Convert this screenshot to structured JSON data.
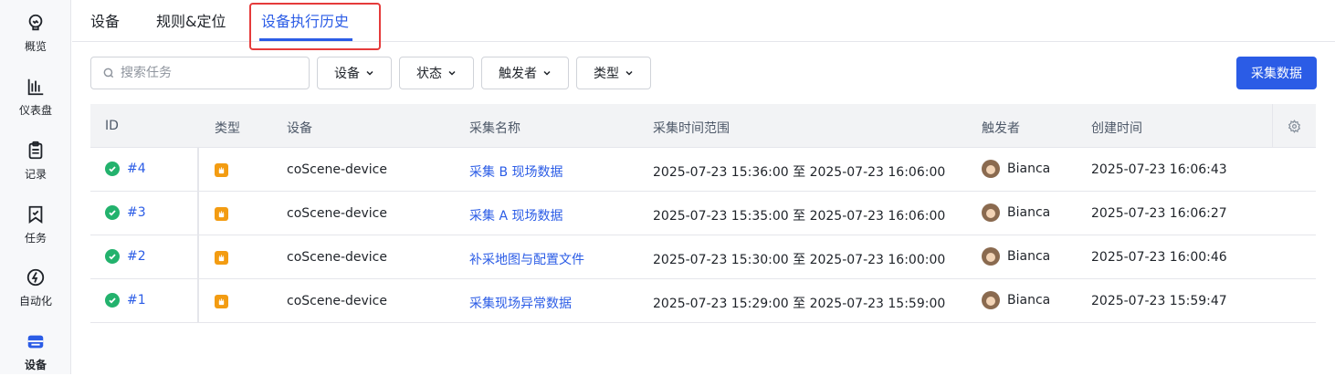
{
  "sidebar": {
    "items": [
      {
        "label": "概览",
        "icon": "bulb-icon"
      },
      {
        "label": "仪表盘",
        "icon": "bar-chart-icon"
      },
      {
        "label": "记录",
        "icon": "clipboard-icon"
      },
      {
        "label": "任务",
        "icon": "task-icon"
      },
      {
        "label": "自动化",
        "icon": "automation-icon"
      },
      {
        "label": "设备",
        "icon": "device-icon",
        "active": true
      }
    ]
  },
  "tabs": [
    {
      "label": "设备"
    },
    {
      "label": "规则&定位"
    },
    {
      "label": "设备执行历史",
      "active": true
    }
  ],
  "toolbar": {
    "search_placeholder": "搜索任务",
    "filters": [
      {
        "label": "设备"
      },
      {
        "label": "状态"
      },
      {
        "label": "触发者"
      },
      {
        "label": "类型"
      }
    ],
    "collect_button": "采集数据"
  },
  "table": {
    "columns": [
      "ID",
      "类型",
      "设备",
      "采集名称",
      "采集时间范围",
      "触发者",
      "创建时间"
    ],
    "rows": [
      {
        "id": "#4",
        "device": "coScene-device",
        "name": "采集 B 现场数据",
        "range": "2025-07-23 15:36:00 至 2025-07-23 16:06:00",
        "trigger": "Bianca",
        "created": "2025-07-23 16:06:43"
      },
      {
        "id": "#3",
        "device": "coScene-device",
        "name": "采集 A 现场数据",
        "range": "2025-07-23 15:35:00 至 2025-07-23 16:06:00",
        "trigger": "Bianca",
        "created": "2025-07-23 16:06:27"
      },
      {
        "id": "#2",
        "device": "coScene-device",
        "name": "补采地图与配置文件",
        "range": "2025-07-23 15:30:00 至 2025-07-23 16:00:00",
        "trigger": "Bianca",
        "created": "2025-07-23 16:00:46"
      },
      {
        "id": "#1",
        "device": "coScene-device",
        "name": "采集现场异常数据",
        "range": "2025-07-23 15:29:00 至 2025-07-23 15:59:00",
        "trigger": "Bianca",
        "created": "2025-07-23 15:59:47"
      }
    ]
  },
  "colors": {
    "accent": "#2b5ce6",
    "success": "#23b26d",
    "type_badge": "#f39c12",
    "highlight": "#e53b3b"
  }
}
